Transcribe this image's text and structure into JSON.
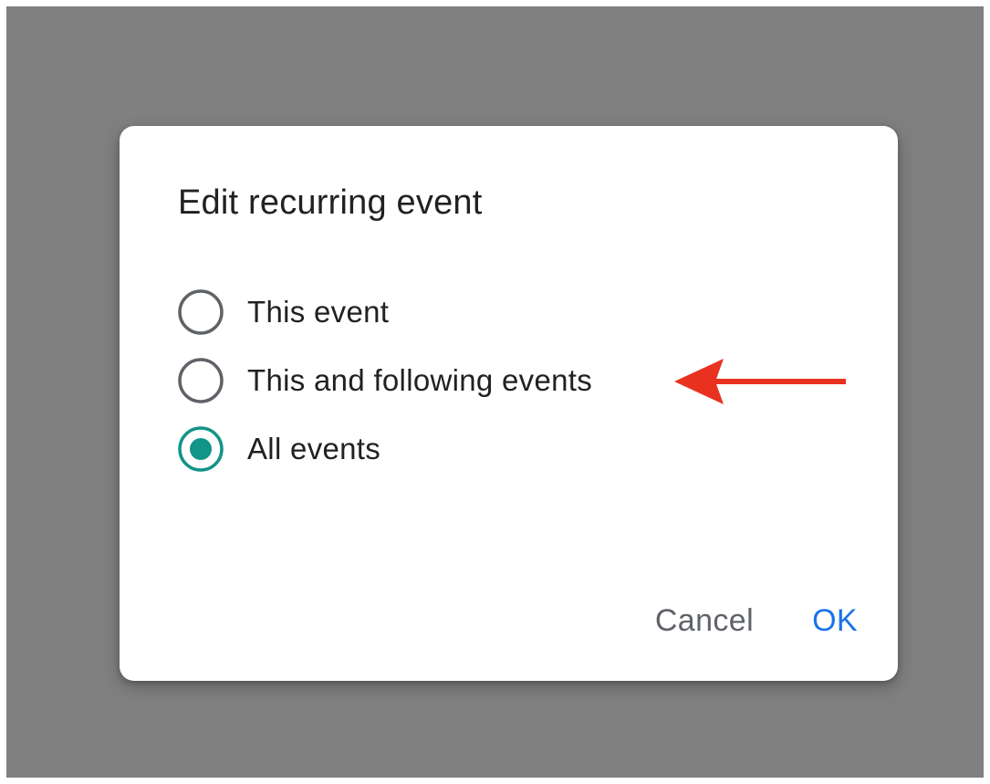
{
  "dialog": {
    "title": "Edit recurring event",
    "options": [
      {
        "label": "This event",
        "selected": false
      },
      {
        "label": "This and following events",
        "selected": false
      },
      {
        "label": "All events",
        "selected": true
      }
    ],
    "cancel_label": "Cancel",
    "ok_label": "OK"
  },
  "annotation": {
    "type": "arrow-left-icon",
    "points_to": "This and following events",
    "color": "#e8321f"
  },
  "colors": {
    "overlay": "#808080",
    "radio_selected": "#129488",
    "radio_unselected": "#5f6368",
    "ok_text": "#1a73e8",
    "cancel_text": "#5f6368"
  }
}
